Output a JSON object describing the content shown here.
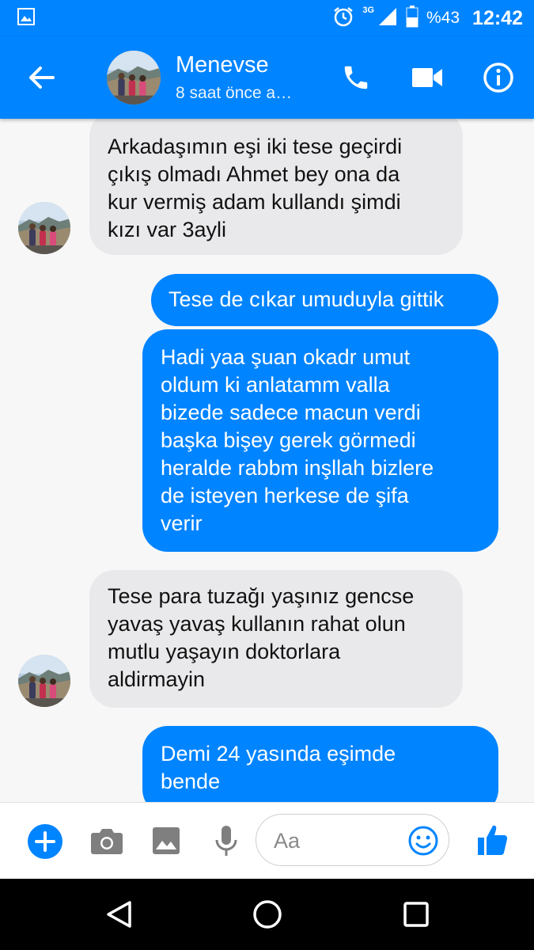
{
  "status_bar": {
    "network": "3G",
    "battery": "%43",
    "time": "12:42",
    "icons": [
      "image-notification-icon",
      "alarm-icon",
      "signal-icon",
      "battery-icon"
    ]
  },
  "header": {
    "contact_name": "Menevse",
    "contact_status": "8 saat önce a…",
    "icons": [
      "back-arrow-icon",
      "phone-icon",
      "video-camera-icon",
      "info-icon"
    ],
    "accent_color": "#0084ff"
  },
  "messages": [
    {
      "direction": "incoming",
      "text": "Arkadaşımın eşi iki tese geçirdi\nçıkış olmadı Ahmet bey ona da\nkur vermiş adam kullandı şimdi\nkızı var 3ayli"
    },
    {
      "direction": "outgoing",
      "text": "Tese de cıkar umuduyla  gittik"
    },
    {
      "direction": "outgoing",
      "text": "Hadi yaa şuan okadr umut\noldum ki anlatamm valla\nbizede sadece macun verdi\nbaşka bişey gerek görmedi\nheralde rabbm  inşllah bizlere\nde isteyen herkese de şifa\nverir"
    },
    {
      "direction": "incoming",
      "text": "Tese para tuzağı yaşınız gencse\nyavaş yavaş kullanın rahat olun\nmutlu yaşayın doktorlara\naldirmayin"
    },
    {
      "direction": "outgoing",
      "text": "Demi 24 yasında eşimde\nbende"
    }
  ],
  "composer": {
    "placeholder": "Aa",
    "icons": [
      "plus-icon",
      "camera-icon",
      "gallery-icon",
      "microphone-icon",
      "emoji-icon",
      "thumbs-up-icon"
    ]
  },
  "navigation": {
    "icons": [
      "back-triangle-icon",
      "home-circle-icon",
      "recents-square-icon"
    ]
  }
}
